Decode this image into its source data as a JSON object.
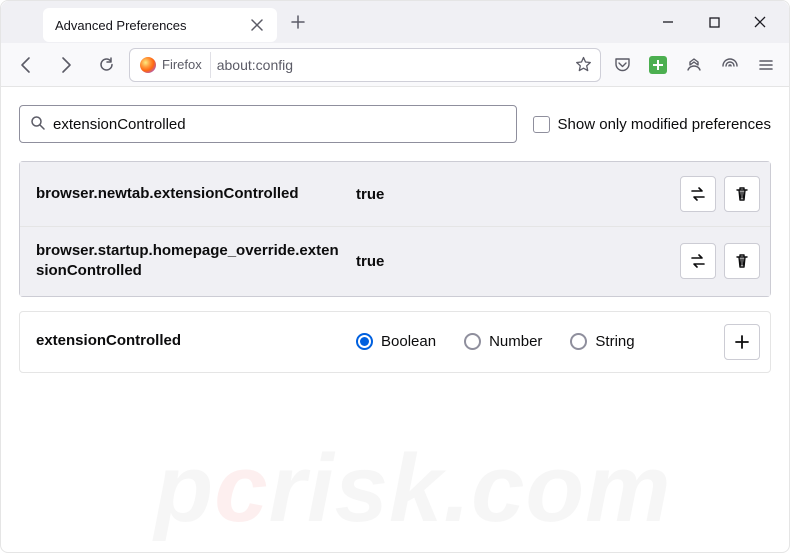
{
  "tab": {
    "title": "Advanced Preferences"
  },
  "urlbar": {
    "identity_label": "Firefox",
    "url": "about:config"
  },
  "search": {
    "value": "extensionControlled"
  },
  "checkbox": {
    "label": "Show only modified preferences"
  },
  "prefs": [
    {
      "name": "browser.newtab.extensionControlled",
      "value": "true"
    },
    {
      "name": "browser.startup.homepage_override.extensionControlled",
      "value": "true"
    }
  ],
  "add_row": {
    "name": "extensionControlled",
    "types": {
      "boolean": "Boolean",
      "number": "Number",
      "string": "String"
    }
  },
  "watermark": {
    "p": "p",
    "c": "c",
    "rest": "risk.com"
  }
}
